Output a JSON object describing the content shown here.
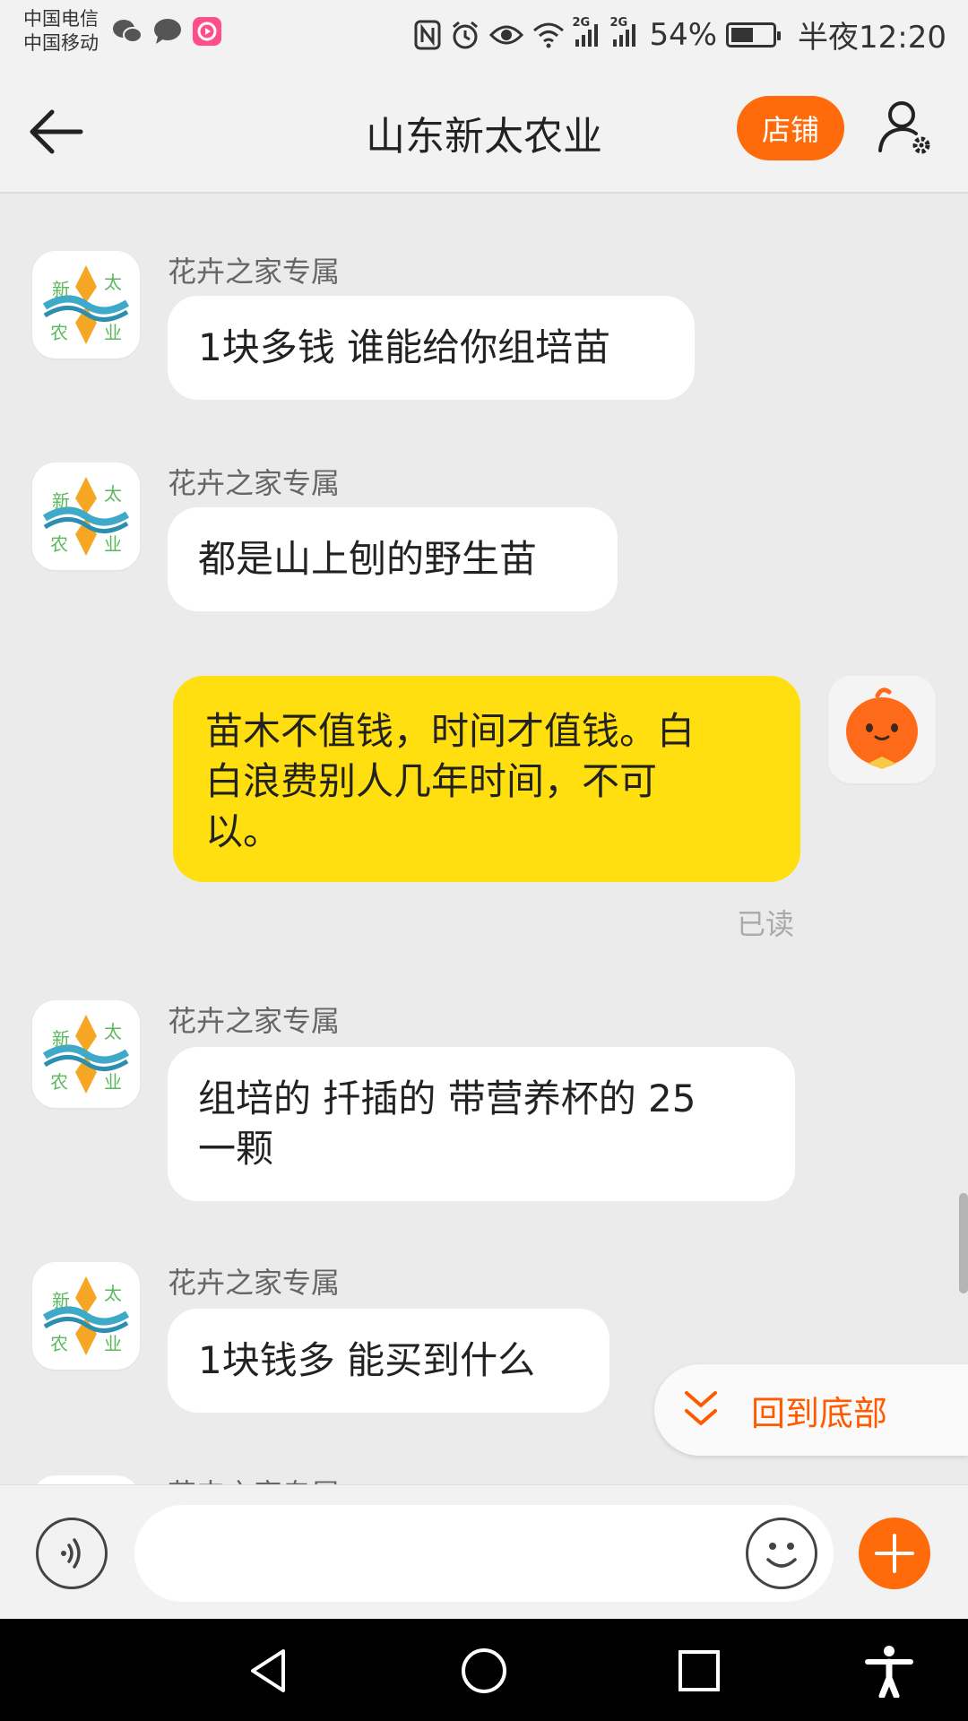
{
  "status_bar": {
    "carrier_1": "中国电信",
    "carrier_2": "中国移动",
    "network_1": "2G",
    "network_2": "2G",
    "battery": "54%",
    "battery_level": 0.54,
    "time": "半夜12:20",
    "icons": [
      "nfc-icon",
      "alarm-icon",
      "eye-icon",
      "wifi-icon",
      "signal-icon",
      "signal-icon",
      "battery-icon"
    ],
    "app_icons": [
      "wechat-icon",
      "message-icon",
      "video-app-icon"
    ]
  },
  "header": {
    "title": "山东新太农业",
    "shop_label": "店铺",
    "icons": [
      "back-arrow-icon",
      "user-settings-icon"
    ]
  },
  "messages": [
    {
      "sender": "花卉之家专属",
      "avatar_text": [
        "新",
        "太",
        "农",
        "业"
      ],
      "text": "1块多钱 谁能给你组培苗",
      "side": "left"
    },
    {
      "sender": "花卉之家专属",
      "avatar_text": [
        "新",
        "太",
        "农",
        "业"
      ],
      "text": "都是山上刨的野生苗",
      "side": "left"
    },
    {
      "sender": "",
      "text_lines": [
        "苗木不值钱，时间才值钱。白",
        "白浪费别人几年时间，不可",
        "以。"
      ],
      "side": "right",
      "status": "已读"
    },
    {
      "sender": "花卉之家专属",
      "avatar_text": [
        "新",
        "太",
        "农",
        "业"
      ],
      "text_lines": [
        "组培的 扦插的 带营养杯的 25",
        "一颗"
      ],
      "side": "left"
    },
    {
      "sender": "花卉之家专属",
      "avatar_text": [
        "新",
        "太",
        "农",
        "业"
      ],
      "text": "1块钱多 能买到什么",
      "side": "left"
    },
    {
      "sender": "花卉之家专属",
      "side": "left"
    }
  ],
  "back_to_bottom_label": "回到底部",
  "input_bar": {
    "placeholder": "",
    "icons": [
      "voice-icon",
      "emoji-icon",
      "plus-icon"
    ]
  },
  "nav_bar": {
    "icons": [
      "nav-back-icon",
      "nav-home-icon",
      "nav-recent-icon",
      "accessibility-icon"
    ]
  },
  "colors": {
    "accent": "#ff6a0a",
    "my_bubble": "#ffdf0f",
    "background": "#ebebeb"
  }
}
